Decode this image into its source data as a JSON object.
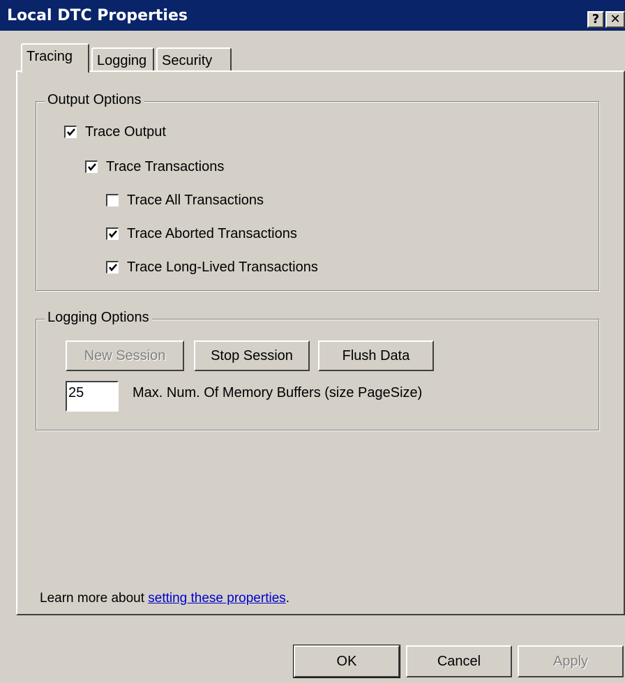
{
  "window": {
    "title": "Local DTC Properties",
    "help_label": "?",
    "close_label": "✕"
  },
  "tabs": [
    {
      "label": "Tracing",
      "active": true
    },
    {
      "label": "Logging",
      "active": false
    },
    {
      "label": "Security",
      "active": false
    }
  ],
  "output_options": {
    "label": "Output Options",
    "trace_output": {
      "label": "Trace Output",
      "checked": true
    },
    "trace_transactions": {
      "label": "Trace Transactions",
      "checked": true
    },
    "trace_all": {
      "label": "Trace All Transactions",
      "checked": false
    },
    "trace_aborted": {
      "label": "Trace Aborted Transactions",
      "checked": true
    },
    "trace_long_lived": {
      "label": "Trace Long-Lived Transactions",
      "checked": true
    }
  },
  "logging_options": {
    "label": "Logging Options",
    "new_session": "New Session",
    "stop_session": "Stop Session",
    "flush_data": "Flush Data",
    "buffers_value": "25",
    "buffers_label": "Max. Num. Of Memory Buffers (size PageSize)"
  },
  "learn_more": {
    "prefix": "Learn more about ",
    "link": "setting these properties",
    "suffix": "."
  },
  "footer": {
    "ok": "OK",
    "cancel": "Cancel",
    "apply": "Apply"
  }
}
